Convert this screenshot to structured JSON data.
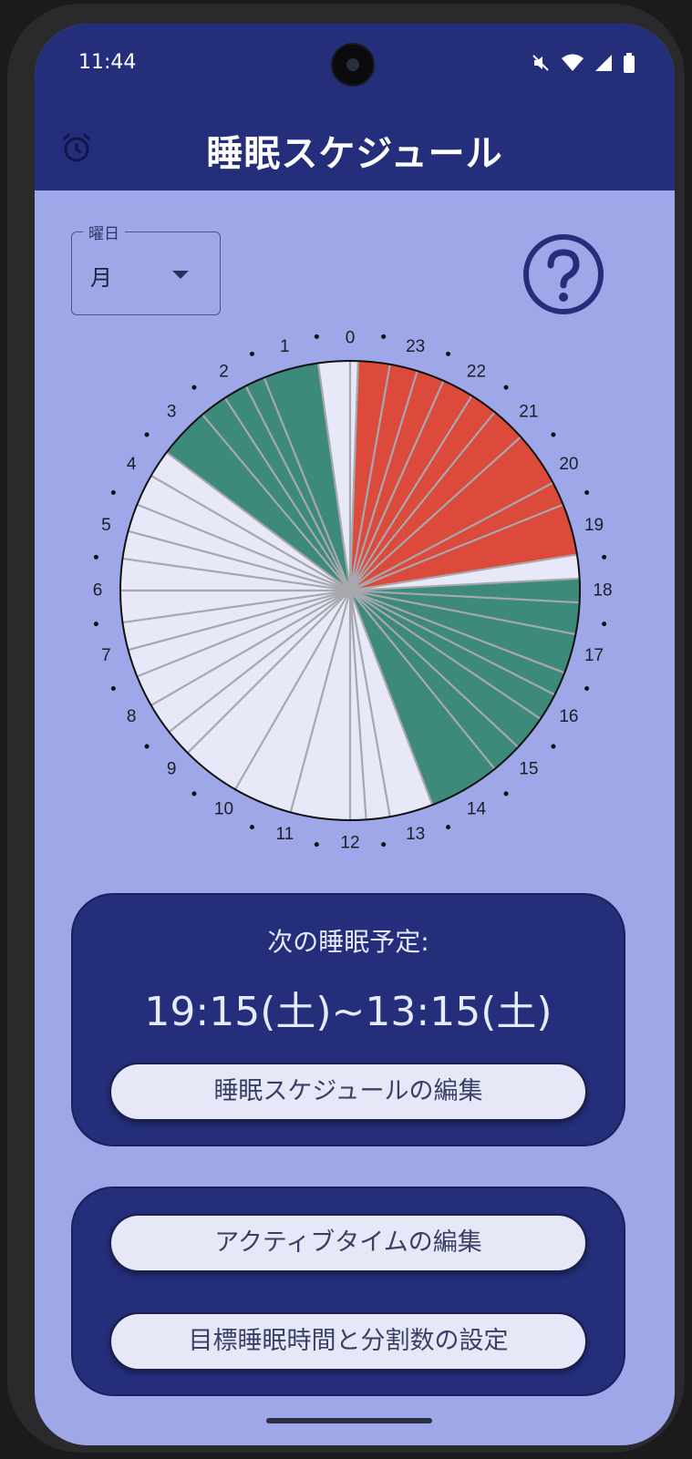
{
  "status_bar": {
    "time": "11:44"
  },
  "header": {
    "title": "睡眠スケジュール",
    "icon": "alarm-clock-icon"
  },
  "day_selector": {
    "label": "曜日",
    "value": "月"
  },
  "help": {
    "icon": "help-circle-icon"
  },
  "clock": {
    "hour_labels": [
      "12",
      "11",
      "10",
      "9",
      "8",
      "7",
      "6",
      "5",
      "4",
      "3",
      "2",
      "1",
      "0",
      "23",
      "22",
      "21",
      "20",
      "19",
      "18",
      "17",
      "16",
      "15",
      "14",
      "13"
    ],
    "colors": {
      "empty": "#e7e9f9",
      "red": "#db4a3b",
      "green": "#3d8a7a"
    }
  },
  "next_sleep": {
    "label": "次の睡眠予定:",
    "value": "19:15(土)~13:15(土)",
    "edit_button": "睡眠スケジュールの編集"
  },
  "actions": {
    "active_time_button": "アクティブタイムの編集",
    "target_button": "目標睡眠時間と分割数の設定"
  }
}
